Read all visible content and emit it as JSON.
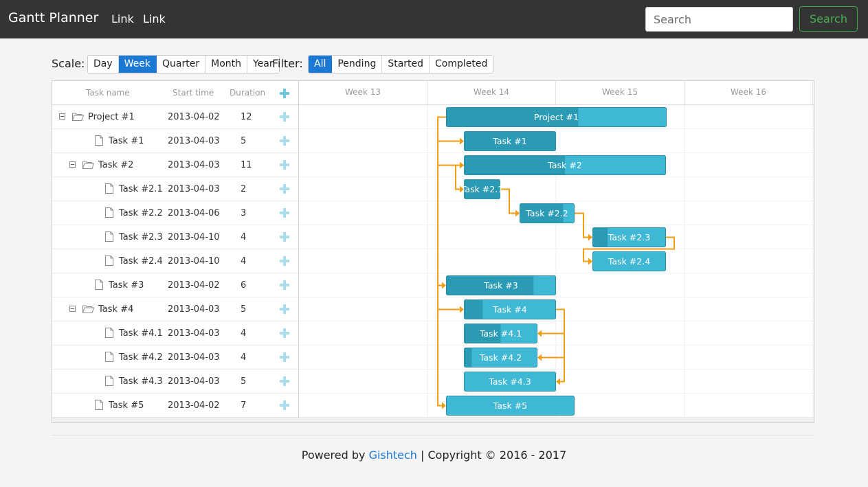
{
  "nav": {
    "brand": "Gantt Planner",
    "links": [
      "Link",
      "Link"
    ],
    "search_placeholder": "Search",
    "search_button": "Search"
  },
  "toolbar": {
    "scale_label": "Scale:",
    "scales": [
      "Day",
      "Week",
      "Quarter",
      "Month",
      "Year"
    ],
    "active_scale": "Week",
    "filter_label": "Filter:",
    "filters": [
      "All",
      "Pending",
      "Started",
      "Completed"
    ],
    "active_filter": "All"
  },
  "grid": {
    "columns": [
      "Task name",
      "Start time",
      "Duration"
    ],
    "rows": [
      {
        "name": "Project #1",
        "start": "2013-04-02",
        "duration": "12",
        "level": 0,
        "folder": true
      },
      {
        "name": "Task #1",
        "start": "2013-04-03",
        "duration": "5",
        "level": 1,
        "folder": false
      },
      {
        "name": "Task #2",
        "start": "2013-04-03",
        "duration": "11",
        "level": 1,
        "folder": true
      },
      {
        "name": "Task #2.1",
        "start": "2013-04-03",
        "duration": "2",
        "level": 2,
        "folder": false
      },
      {
        "name": "Task #2.2",
        "start": "2013-04-06",
        "duration": "3",
        "level": 2,
        "folder": false
      },
      {
        "name": "Task #2.3",
        "start": "2013-04-10",
        "duration": "4",
        "level": 2,
        "folder": false
      },
      {
        "name": "Task #2.4",
        "start": "2013-04-10",
        "duration": "4",
        "level": 2,
        "folder": false
      },
      {
        "name": "Task #3",
        "start": "2013-04-02",
        "duration": "6",
        "level": 1,
        "folder": false
      },
      {
        "name": "Task #4",
        "start": "2013-04-03",
        "duration": "5",
        "level": 1,
        "folder": true
      },
      {
        "name": "Task #4.1",
        "start": "2013-04-03",
        "duration": "4",
        "level": 2,
        "folder": false
      },
      {
        "name": "Task #4.2",
        "start": "2013-04-03",
        "duration": "4",
        "level": 2,
        "folder": false
      },
      {
        "name": "Task #4.3",
        "start": "2013-04-03",
        "duration": "5",
        "level": 2,
        "folder": false
      },
      {
        "name": "Task #5",
        "start": "2013-04-02",
        "duration": "7",
        "level": 1,
        "folder": false
      }
    ]
  },
  "timeline": {
    "weeks": [
      "Week 13",
      "Week 14",
      "Week 15",
      "Week 16"
    ],
    "bars": [
      {
        "label": "Project #1",
        "progress": 0.6
      },
      {
        "label": "Task #1",
        "progress": 1.0
      },
      {
        "label": "Task #2",
        "progress": 0.5
      },
      {
        "label": "Task #2.1",
        "progress": 1.0
      },
      {
        "label": "Task #2.2",
        "progress": 0.8
      },
      {
        "label": "Task #2.3",
        "progress": 0.2
      },
      {
        "label": "Task #2.4",
        "progress": 0.0
      },
      {
        "label": "Task #3",
        "progress": 0.8
      },
      {
        "label": "Task #4",
        "progress": 0.2
      },
      {
        "label": "Task #4.1",
        "progress": 0.5
      },
      {
        "label": "Task #4.2",
        "progress": 0.1
      },
      {
        "label": "Task #4.3",
        "progress": 0.0
      },
      {
        "label": "Task #5",
        "progress": 0.0
      }
    ],
    "colors": {
      "done": "#2b9bb5",
      "todo": "#3fb8d5",
      "link": "#f39c12"
    }
  },
  "footer": {
    "prefix": "Powered by",
    "company": "Gishtech",
    "suffix": "| Copyright © 2016 - 2017"
  }
}
